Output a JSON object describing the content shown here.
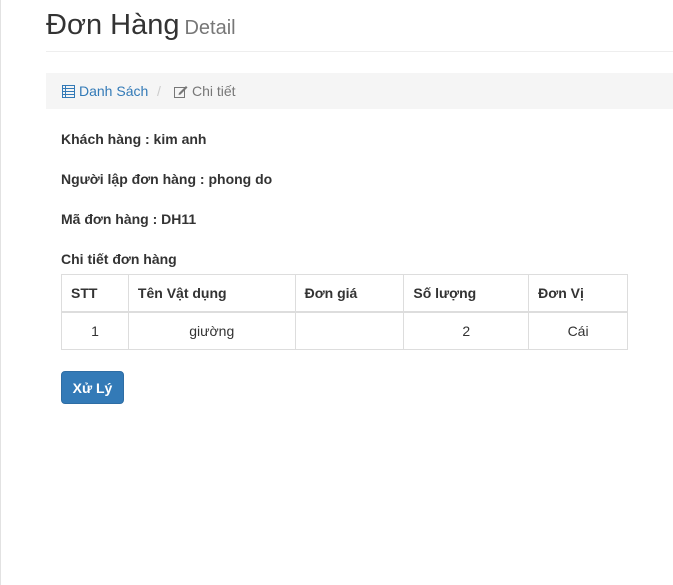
{
  "header": {
    "title": "Đơn Hàng",
    "subtitle": "Detail"
  },
  "breadcrumb": {
    "list_label": "Danh Sách",
    "separator": "/",
    "current_label": "Chi tiết",
    "list_icon": "list-icon",
    "current_icon": "edit-icon"
  },
  "order": {
    "customer_label": "Khách hàng : kim anh",
    "creator_label": "Người lập đơn hàng : phong do",
    "code_label": "Mã đơn hàng : DH11",
    "details_heading": "Chi tiết đơn hàng"
  },
  "table": {
    "columns": [
      "STT",
      "Tên Vật dụng",
      "Đơn giá",
      "Số lượng",
      "Đơn Vị"
    ],
    "rows": [
      {
        "stt": "1",
        "item": "giường",
        "price": "",
        "quantity": "2",
        "unit": "Cái"
      }
    ]
  },
  "actions": {
    "process_label": "Xử Lý"
  },
  "colors": {
    "primary": "#337ab7",
    "breadcrumb_bg": "#f5f5f5",
    "border": "#dddddd"
  }
}
